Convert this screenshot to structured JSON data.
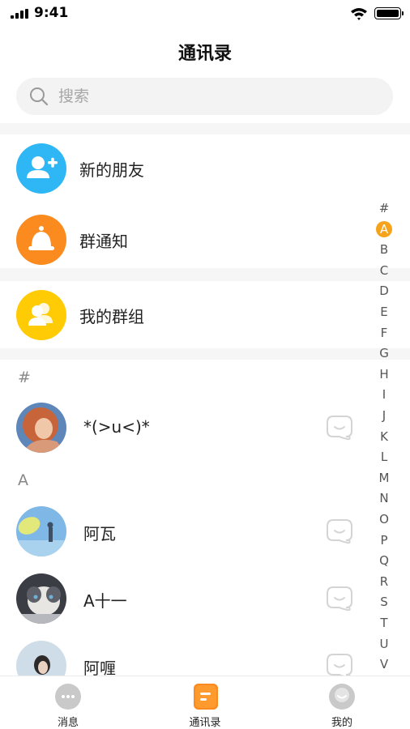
{
  "status_bar": {
    "time": "9:41",
    "battery_level": 1.0
  },
  "header": {
    "title": "通讯录"
  },
  "search": {
    "placeholder": "搜索"
  },
  "menu": [
    {
      "label": "新的朋友",
      "icon": "add-friend-icon",
      "color": "#2fb7f5"
    },
    {
      "label": "群通知",
      "icon": "bell-icon",
      "color": "#fb8a1f"
    },
    {
      "label": "我的群组",
      "icon": "group-icon",
      "color": "#ffcb05"
    }
  ],
  "sections": [
    {
      "header": "#",
      "contacts": [
        {
          "name": "*(>u<)*",
          "avatar": "photo-avatar-icon"
        }
      ]
    },
    {
      "header": "A",
      "contacts": [
        {
          "name": "阿瓦",
          "avatar": "photo-avatar-icon"
        },
        {
          "name": "A十一",
          "avatar": "photo-avatar-icon"
        },
        {
          "name": "阿喱",
          "avatar": "photo-avatar-icon"
        }
      ]
    }
  ],
  "index_bar": {
    "letters": [
      "#",
      "A",
      "B",
      "C",
      "D",
      "E",
      "F",
      "G",
      "H",
      "I",
      "J",
      "K",
      "L",
      "M",
      "N",
      "O",
      "P",
      "Q",
      "R",
      "S",
      "T",
      "U",
      "V"
    ],
    "active": "A",
    "active_color": "#f6a21a"
  },
  "tab_bar": {
    "tabs": [
      {
        "label": "消息",
        "icon": "message-icon",
        "active": false
      },
      {
        "label": "通讯录",
        "icon": "contacts-icon",
        "active": true
      },
      {
        "label": "我的",
        "icon": "profile-icon",
        "active": false
      }
    ]
  }
}
